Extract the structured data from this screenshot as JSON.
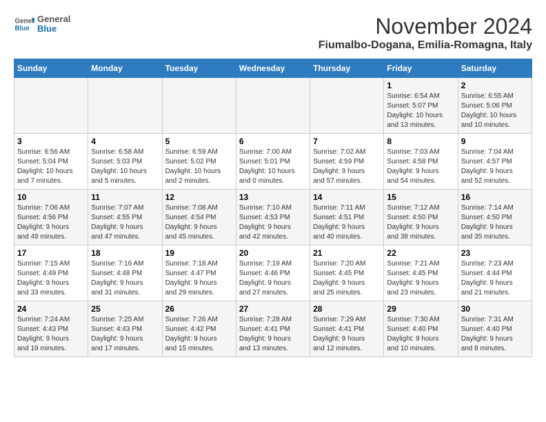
{
  "header": {
    "logo_general": "General",
    "logo_blue": "Blue",
    "month_title": "November 2024",
    "location": "Fiumalbo-Dogana, Emilia-Romagna, Italy"
  },
  "days_of_week": [
    "Sunday",
    "Monday",
    "Tuesday",
    "Wednesday",
    "Thursday",
    "Friday",
    "Saturday"
  ],
  "weeks": [
    [
      {
        "day": "",
        "info": ""
      },
      {
        "day": "",
        "info": ""
      },
      {
        "day": "",
        "info": ""
      },
      {
        "day": "",
        "info": ""
      },
      {
        "day": "",
        "info": ""
      },
      {
        "day": "1",
        "info": "Sunrise: 6:54 AM\nSunset: 5:07 PM\nDaylight: 10 hours\nand 13 minutes."
      },
      {
        "day": "2",
        "info": "Sunrise: 6:55 AM\nSunset: 5:06 PM\nDaylight: 10 hours\nand 10 minutes."
      }
    ],
    [
      {
        "day": "3",
        "info": "Sunrise: 6:56 AM\nSunset: 5:04 PM\nDaylight: 10 hours\nand 7 minutes."
      },
      {
        "day": "4",
        "info": "Sunrise: 6:58 AM\nSunset: 5:03 PM\nDaylight: 10 hours\nand 5 minutes."
      },
      {
        "day": "5",
        "info": "Sunrise: 6:59 AM\nSunset: 5:02 PM\nDaylight: 10 hours\nand 2 minutes."
      },
      {
        "day": "6",
        "info": "Sunrise: 7:00 AM\nSunset: 5:01 PM\nDaylight: 10 hours\nand 0 minutes."
      },
      {
        "day": "7",
        "info": "Sunrise: 7:02 AM\nSunset: 4:59 PM\nDaylight: 9 hours\nand 57 minutes."
      },
      {
        "day": "8",
        "info": "Sunrise: 7:03 AM\nSunset: 4:58 PM\nDaylight: 9 hours\nand 54 minutes."
      },
      {
        "day": "9",
        "info": "Sunrise: 7:04 AM\nSunset: 4:57 PM\nDaylight: 9 hours\nand 52 minutes."
      }
    ],
    [
      {
        "day": "10",
        "info": "Sunrise: 7:06 AM\nSunset: 4:56 PM\nDaylight: 9 hours\nand 49 minutes."
      },
      {
        "day": "11",
        "info": "Sunrise: 7:07 AM\nSunset: 4:55 PM\nDaylight: 9 hours\nand 47 minutes."
      },
      {
        "day": "12",
        "info": "Sunrise: 7:08 AM\nSunset: 4:54 PM\nDaylight: 9 hours\nand 45 minutes."
      },
      {
        "day": "13",
        "info": "Sunrise: 7:10 AM\nSunset: 4:53 PM\nDaylight: 9 hours\nand 42 minutes."
      },
      {
        "day": "14",
        "info": "Sunrise: 7:11 AM\nSunset: 4:51 PM\nDaylight: 9 hours\nand 40 minutes."
      },
      {
        "day": "15",
        "info": "Sunrise: 7:12 AM\nSunset: 4:50 PM\nDaylight: 9 hours\nand 38 minutes."
      },
      {
        "day": "16",
        "info": "Sunrise: 7:14 AM\nSunset: 4:50 PM\nDaylight: 9 hours\nand 35 minutes."
      }
    ],
    [
      {
        "day": "17",
        "info": "Sunrise: 7:15 AM\nSunset: 4:49 PM\nDaylight: 9 hours\nand 33 minutes."
      },
      {
        "day": "18",
        "info": "Sunrise: 7:16 AM\nSunset: 4:48 PM\nDaylight: 9 hours\nand 31 minutes."
      },
      {
        "day": "19",
        "info": "Sunrise: 7:18 AM\nSunset: 4:47 PM\nDaylight: 9 hours\nand 29 minutes."
      },
      {
        "day": "20",
        "info": "Sunrise: 7:19 AM\nSunset: 4:46 PM\nDaylight: 9 hours\nand 27 minutes."
      },
      {
        "day": "21",
        "info": "Sunrise: 7:20 AM\nSunset: 4:45 PM\nDaylight: 9 hours\nand 25 minutes."
      },
      {
        "day": "22",
        "info": "Sunrise: 7:21 AM\nSunset: 4:45 PM\nDaylight: 9 hours\nand 23 minutes."
      },
      {
        "day": "23",
        "info": "Sunrise: 7:23 AM\nSunset: 4:44 PM\nDaylight: 9 hours\nand 21 minutes."
      }
    ],
    [
      {
        "day": "24",
        "info": "Sunrise: 7:24 AM\nSunset: 4:43 PM\nDaylight: 9 hours\nand 19 minutes."
      },
      {
        "day": "25",
        "info": "Sunrise: 7:25 AM\nSunset: 4:43 PM\nDaylight: 9 hours\nand 17 minutes."
      },
      {
        "day": "26",
        "info": "Sunrise: 7:26 AM\nSunset: 4:42 PM\nDaylight: 9 hours\nand 15 minutes."
      },
      {
        "day": "27",
        "info": "Sunrise: 7:28 AM\nSunset: 4:41 PM\nDaylight: 9 hours\nand 13 minutes."
      },
      {
        "day": "28",
        "info": "Sunrise: 7:29 AM\nSunset: 4:41 PM\nDaylight: 9 hours\nand 12 minutes."
      },
      {
        "day": "29",
        "info": "Sunrise: 7:30 AM\nSunset: 4:40 PM\nDaylight: 9 hours\nand 10 minutes."
      },
      {
        "day": "30",
        "info": "Sunrise: 7:31 AM\nSunset: 4:40 PM\nDaylight: 9 hours\nand 8 minutes."
      }
    ]
  ]
}
